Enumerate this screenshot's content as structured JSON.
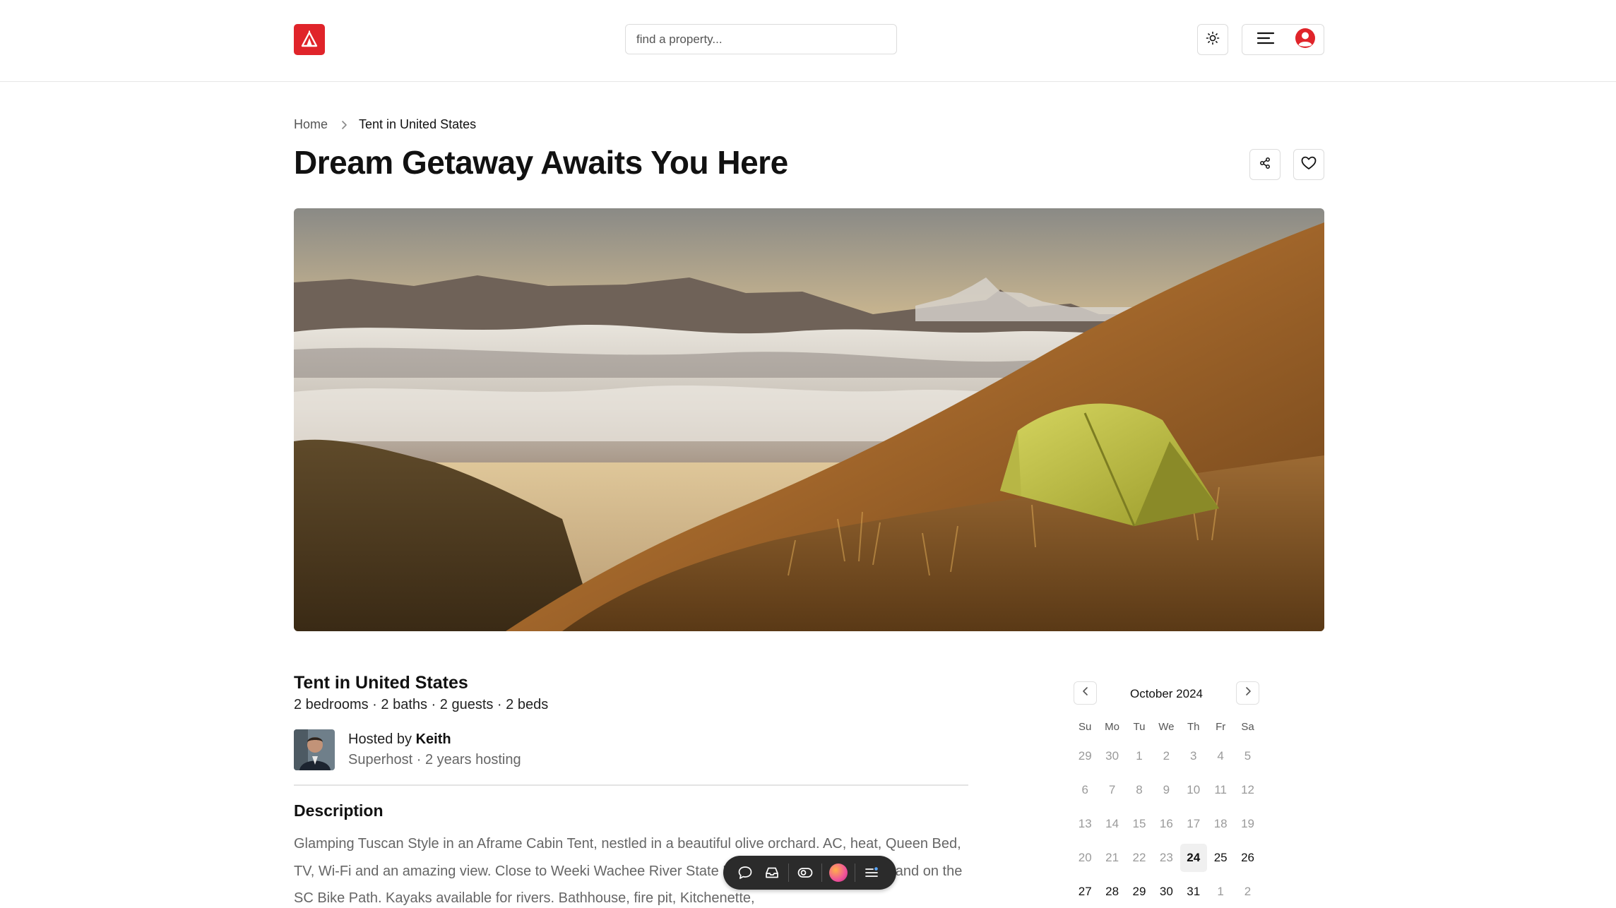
{
  "header": {
    "logo_icon": "tent-logo-icon",
    "brand_color": "#e0242a",
    "search_placeholder": "find a property...",
    "theme_toggle_icon": "sun-icon",
    "menu_icon": "hamburger-menu-icon",
    "avatar_icon": "user-avatar-icon"
  },
  "breadcrumb": {
    "home": "Home",
    "separator_icon": "chevron-right-icon",
    "current": "Tent in United States"
  },
  "page": {
    "title": "Dream Getaway Awaits You Here",
    "share_icon": "share-icon",
    "favorite_icon": "heart-icon"
  },
  "hero": {
    "description": "Tent on a grassy mountain slope above a sea of clouds at sunset"
  },
  "listing": {
    "title": "Tent in United States",
    "stats": "2 bedrooms · 2 baths · 2 guests · 2 beds",
    "host_prefix": "Hosted by ",
    "host_name": "Keith",
    "host_sub": "Superhost · 2 years hosting",
    "description_heading": "Description",
    "description_text": "Glamping Tuscan Style in an Aframe Cabin Tent, nestled in a beautiful olive orchard. AC, heat, Queen Bed, TV, Wi-Fi and an amazing view. Close to Weeki Wachee River State Park, Chassahwitzka River and on the SC Bike Path. Kayaks available for rivers. Bathhouse, fire pit, Kitchenette,"
  },
  "calendar": {
    "month": "October 2024",
    "prev_icon": "chevron-left-icon",
    "next_icon": "chevron-right-icon",
    "weekdays": [
      "Su",
      "Mo",
      "Tu",
      "We",
      "Th",
      "Fr",
      "Sa"
    ],
    "weeks": [
      [
        {
          "d": "29",
          "s": "off"
        },
        {
          "d": "30",
          "s": "off"
        },
        {
          "d": "1",
          "s": "off"
        },
        {
          "d": "2",
          "s": "off"
        },
        {
          "d": "3",
          "s": "off"
        },
        {
          "d": "4",
          "s": "off"
        },
        {
          "d": "5",
          "s": "off"
        }
      ],
      [
        {
          "d": "6",
          "s": "off"
        },
        {
          "d": "7",
          "s": "off"
        },
        {
          "d": "8",
          "s": "off"
        },
        {
          "d": "9",
          "s": "off"
        },
        {
          "d": "10",
          "s": "off"
        },
        {
          "d": "11",
          "s": "off"
        },
        {
          "d": "12",
          "s": "off"
        }
      ],
      [
        {
          "d": "13",
          "s": "off"
        },
        {
          "d": "14",
          "s": "off"
        },
        {
          "d": "15",
          "s": "off"
        },
        {
          "d": "16",
          "s": "off"
        },
        {
          "d": "17",
          "s": "off"
        },
        {
          "d": "18",
          "s": "off"
        },
        {
          "d": "19",
          "s": "off"
        }
      ],
      [
        {
          "d": "20",
          "s": "off"
        },
        {
          "d": "21",
          "s": "off"
        },
        {
          "d": "22",
          "s": "off"
        },
        {
          "d": "23",
          "s": "off"
        },
        {
          "d": "24",
          "s": "today"
        },
        {
          "d": "25",
          "s": "on"
        },
        {
          "d": "26",
          "s": "on"
        }
      ],
      [
        {
          "d": "27",
          "s": "on"
        },
        {
          "d": "28",
          "s": "on"
        },
        {
          "d": "29",
          "s": "on"
        },
        {
          "d": "30",
          "s": "on"
        },
        {
          "d": "31",
          "s": "on"
        },
        {
          "d": "1",
          "s": "off"
        },
        {
          "d": "2",
          "s": "off"
        }
      ]
    ]
  },
  "floating_toolbar": {
    "items": [
      "chat-bubble-icon",
      "inbox-icon",
      "eye-toggle-icon",
      "color-orb-icon",
      "list-menu-icon"
    ]
  }
}
